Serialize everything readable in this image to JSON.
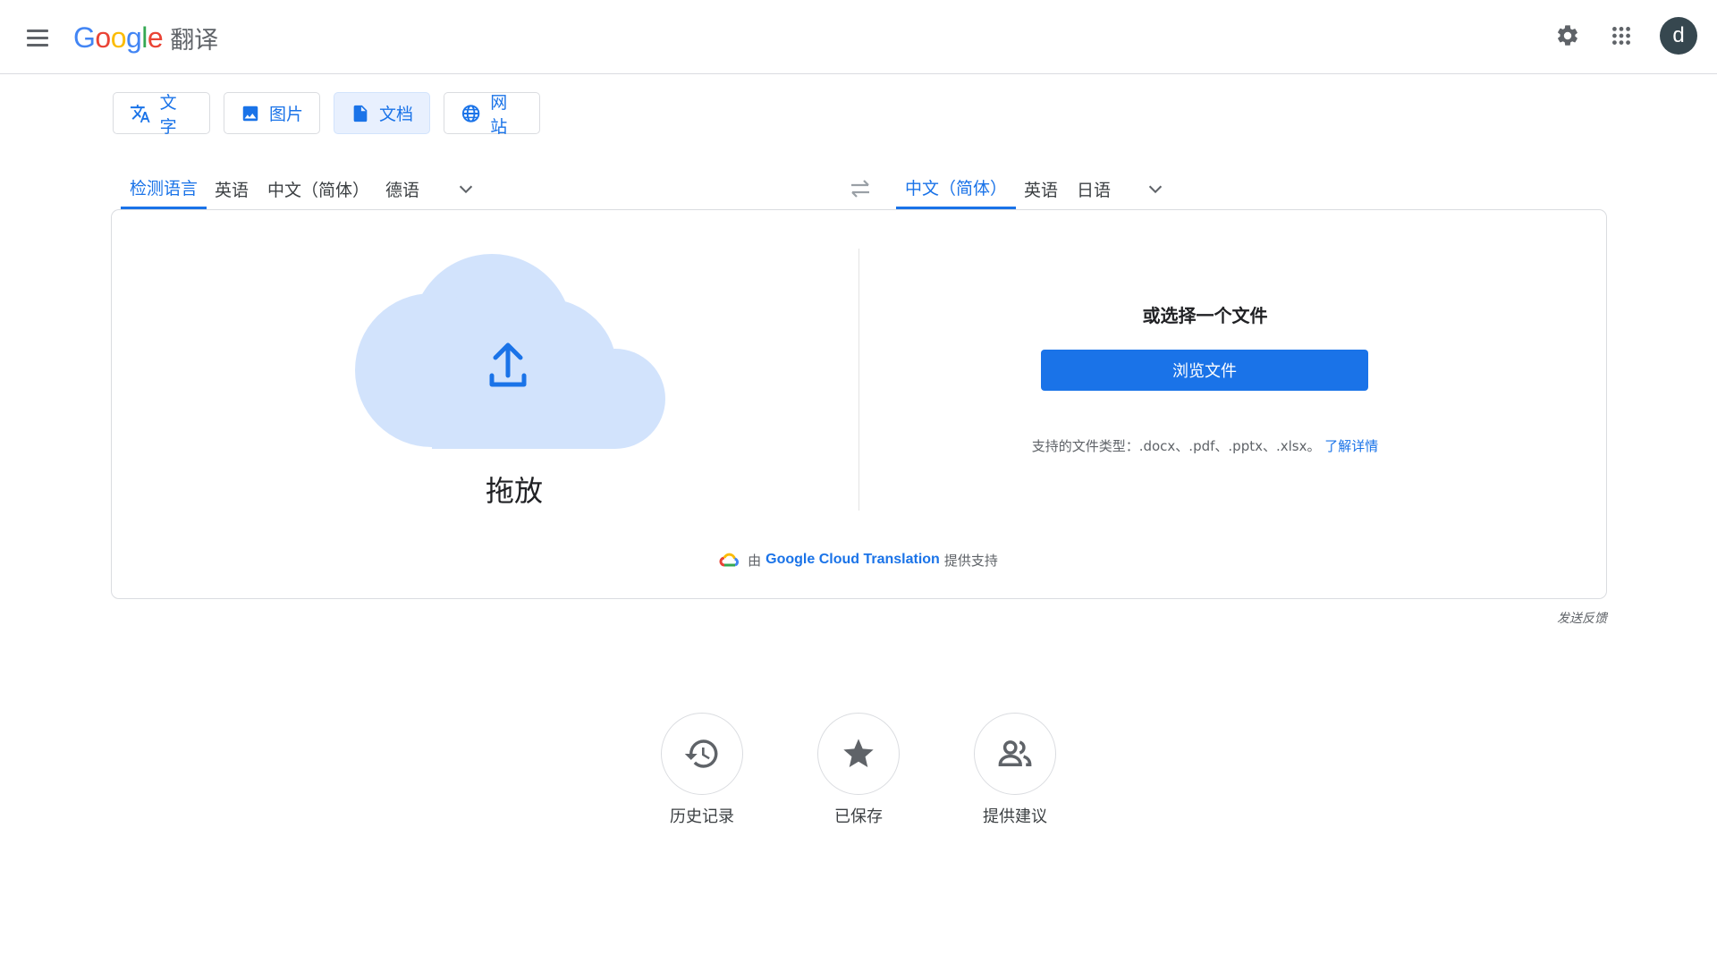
{
  "header": {
    "logo_word": "Google",
    "product_name": "翻译",
    "avatar_letter": "d",
    "icons": [
      "menu-icon",
      "settings-gear-icon",
      "apps-grid-icon"
    ]
  },
  "mode_tabs": [
    {
      "label": "文字",
      "icon": "translate-icon",
      "active": false
    },
    {
      "label": "图片",
      "icon": "image-icon",
      "active": false
    },
    {
      "label": "文档",
      "icon": "document-icon",
      "active": true
    },
    {
      "label": "网站",
      "icon": "globe-icon",
      "active": false
    }
  ],
  "source_languages": [
    {
      "label": "检测语言",
      "active": true
    },
    {
      "label": "英语",
      "active": false
    },
    {
      "label": "中文（简体）",
      "active": false
    },
    {
      "label": "德语",
      "active": false
    }
  ],
  "target_languages": [
    {
      "label": "中文（简体）",
      "active": true
    },
    {
      "label": "英语",
      "active": false
    },
    {
      "label": "日语",
      "active": false
    }
  ],
  "upload": {
    "drop_label": "拖放",
    "choose_title": "或选择一个文件",
    "browse_button": "浏览文件",
    "supported_text": "支持的文件类型：.docx、.pdf、.pptx、.xlsx。",
    "learn_more": "了解详情"
  },
  "powered_by": {
    "prefix": "由",
    "brand": "Google Cloud Translation",
    "suffix": "提供支持"
  },
  "feedback": "发送反馈",
  "bottom_actions": [
    {
      "label": "历史记录",
      "icon": "history-icon"
    },
    {
      "label": "已保存",
      "icon": "star-icon"
    },
    {
      "label": "提供建议",
      "icon": "people-icon"
    }
  ],
  "colors": {
    "accent": "#1a73e8",
    "active_tab_bg": "#e8f0fe",
    "cloud": "#d2e3fc",
    "avatar_bg": "#36474f",
    "border": "#dadce0"
  }
}
